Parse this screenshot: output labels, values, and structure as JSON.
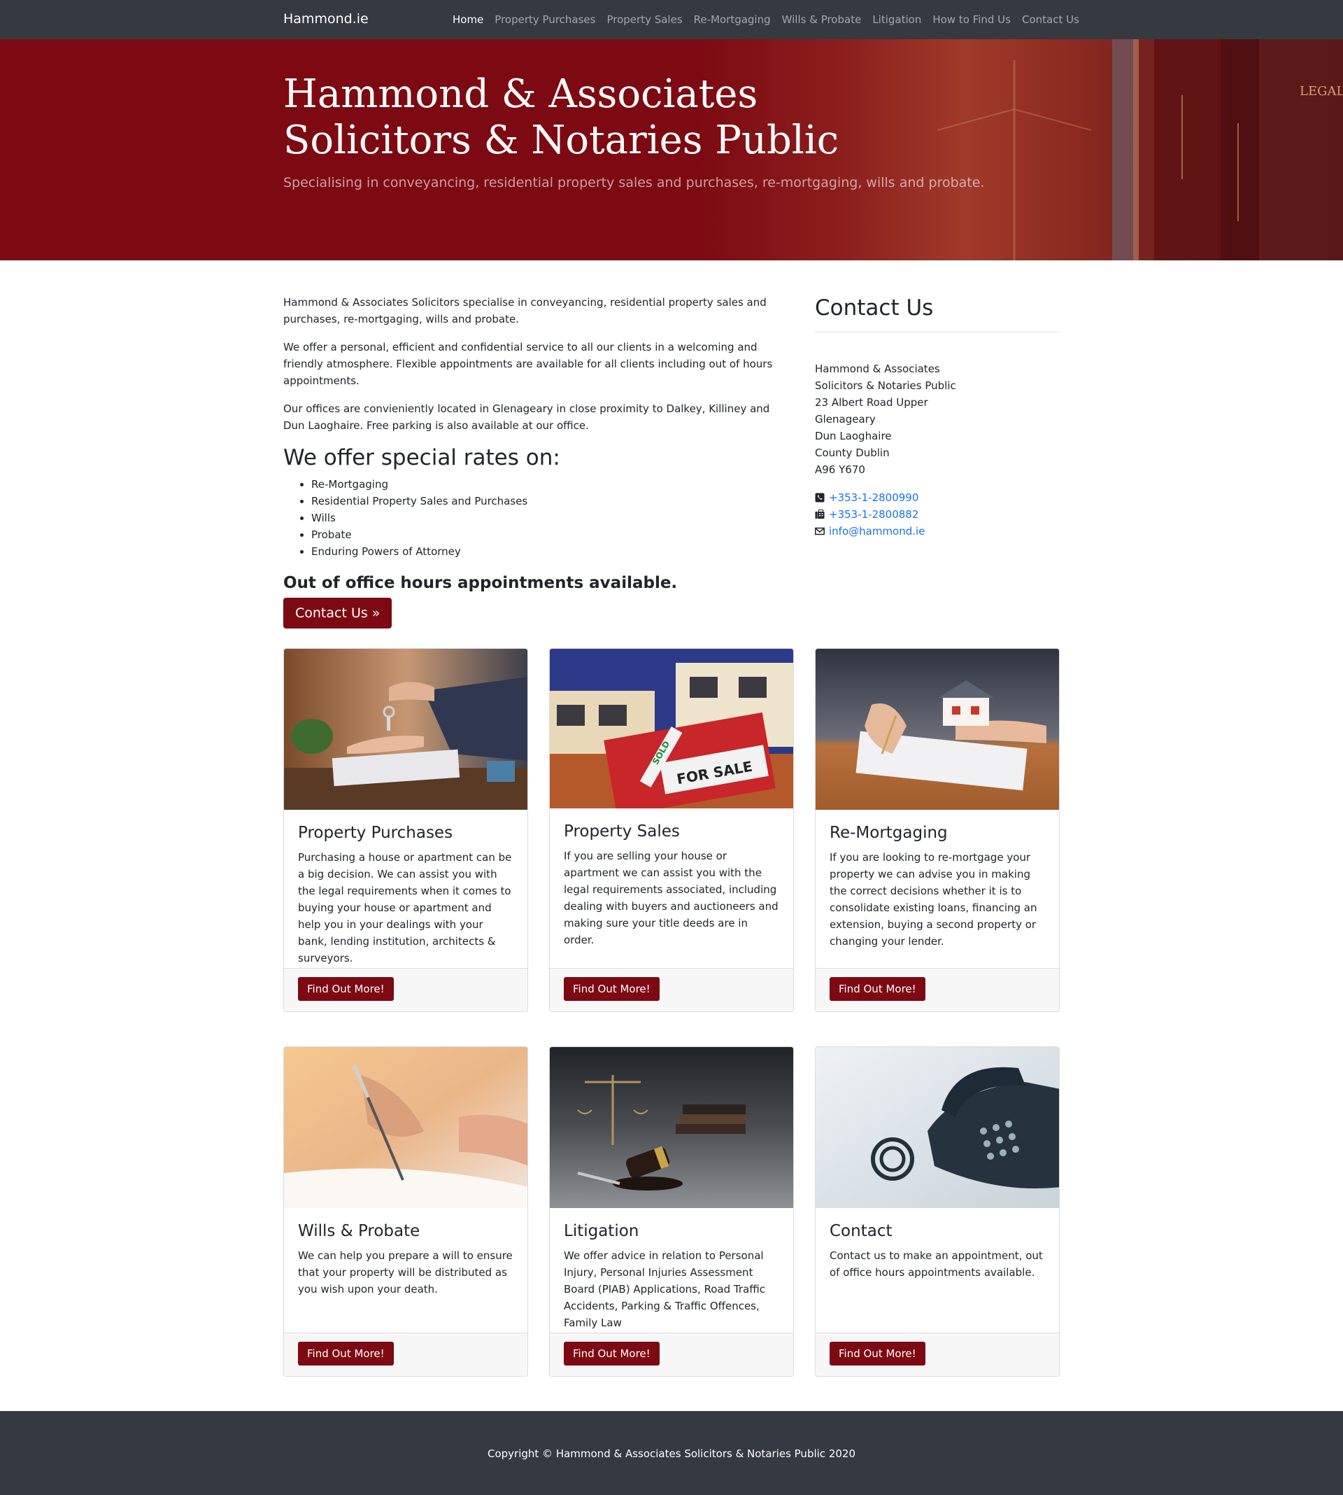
{
  "nav": {
    "brand": "Hammond.ie",
    "links": [
      "Home",
      "Property Purchases",
      "Property Sales",
      "Re-Mortgaging",
      "Wills & Probate",
      "Litigation",
      "How to Find Us",
      "Contact Us"
    ]
  },
  "hero": {
    "title_line1": "Hammond & Associates",
    "title_line2": "Solicitors & Notaries Public",
    "subtitle": "Specialising in conveyancing, residential property sales and purchases, re-mortgaging, wills and probate."
  },
  "intro": {
    "paragraphs": [
      "Hammond & Associates Solicitors specialise in conveyancing, residential property sales and purchases, re-mortgaging, wills and probate.",
      "We offer a personal, efficient and confidential service to all our clients in a welcoming and friendly atmosphere. Flexible appointments are available for all clients including out of hours appointments.",
      "Our offices are convieniently located in Glenageary in close proximity to Dalkey, Killiney and Dun Laoghaire. Free parking is also available at our office."
    ],
    "rates_heading": "We offer special rates on:",
    "rates": [
      "Re-Mortgaging",
      "Residential Property Sales and Purchases",
      "Wills",
      "Probate",
      "Enduring Powers of Attorney"
    ],
    "out_of_hours": "Out of office hours appointments available.",
    "contact_button": "Contact Us »"
  },
  "contact": {
    "heading": "Contact Us",
    "address": [
      "Hammond & Associates",
      "Solicitors & Notaries Public",
      "23 Albert Road Upper",
      "Glenageary",
      "Dun Laoghaire",
      "County Dublin",
      "A96 Y670"
    ],
    "phone": "+353-1-2800990",
    "fax": "+353-1-2800882",
    "email": "info@hammond.ie"
  },
  "cards": [
    {
      "title": "Property Purchases",
      "text": "Purchasing a house or apartment can be a big decision. We can assist you with the legal requirements when it comes to buying your house or apartment and help you in your dealings with your bank, lending institution, architects & surveyors.",
      "button": "Find Out More!"
    },
    {
      "title": "Property Sales",
      "text": "If you are selling your house or apartment we can assist you with the legal requirements associated, including dealing with buyers and auctioneers and making sure your title deeds are in order.",
      "button": "Find Out More!",
      "sign_text": "FOR SALE",
      "sign_banner": "SOLD"
    },
    {
      "title": "Re-Mortgaging",
      "text": "If you are looking to re-mortgage your property we can advise you in making the correct decisions whether it is to consolidate existing loans, financing an extension, buying a second property or changing your lender.",
      "button": "Find Out More!"
    },
    {
      "title": "Wills & Probate",
      "text": "We can help you prepare a will to ensure that your property will be distributed as you wish upon your death.",
      "button": "Find Out More!"
    },
    {
      "title": "Litigation",
      "text": "We offer advice in relation to Personal Injury, Personal Injuries Assessment Board (PIAB) Applications, Road Traffic Accidents, Parking & Traffic Offences, Family Law",
      "button": "Find Out More!"
    },
    {
      "title": "Contact",
      "text": "Contact us to make an appointment, out of office hours appointments available.",
      "button": "Find Out More!"
    }
  ],
  "hero_book_text": "LEGAL",
  "footer": {
    "copyright": "Copyright © Hammond & Associates Solicitors & Notaries Public 2020"
  },
  "colors": {
    "brand_red": "#7d0a12",
    "navbar": "#343a40",
    "link_blue": "#1a73e8"
  }
}
